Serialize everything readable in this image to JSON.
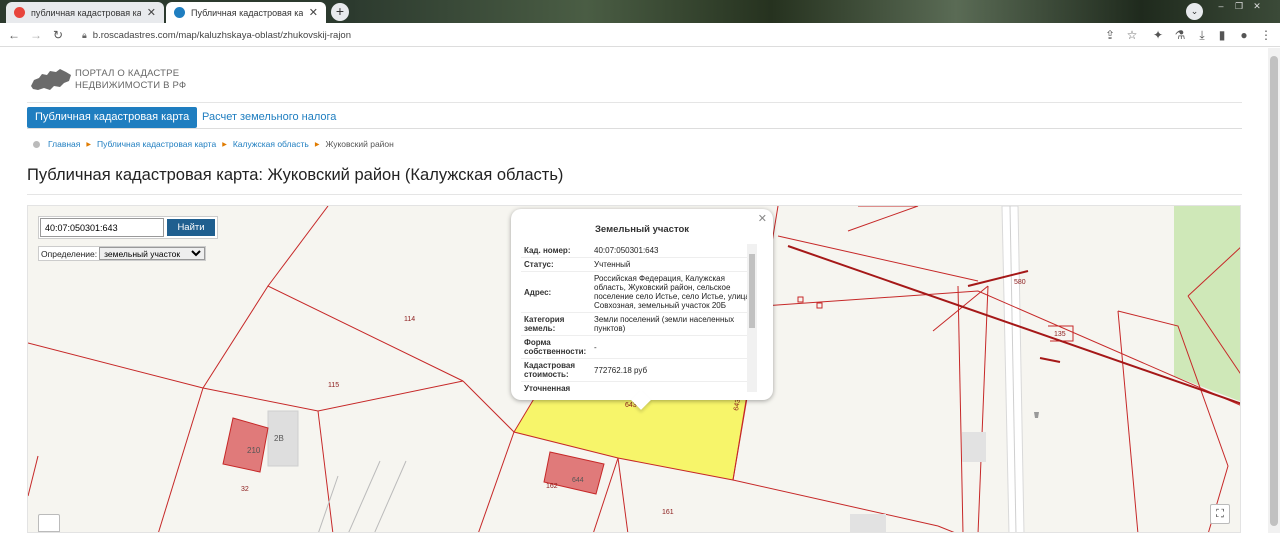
{
  "browser": {
    "tabs": [
      {
        "title": "публичная кадастровая карта ж",
        "active": false,
        "favicon_color": "#e8453c"
      },
      {
        "title": "Публичная кадастровая карта: Ж",
        "active": true,
        "favicon_color": "#1f7ec0"
      }
    ],
    "url": "b.roscadastres.com/map/kaluzhskaya-oblast/zhukovskij-rajon"
  },
  "site": {
    "logo_line1": "ПОРТАЛ О КАДАСТРЕ",
    "logo_line2": "НЕДВИЖИМОСТИ В РФ",
    "nav": {
      "active": "Публичная кадастровая карта",
      "other": "Расчет земельного налога"
    },
    "breadcrumb": [
      "Главная",
      "Публичная кадастровая карта",
      "Калужская область",
      "Жуковский район"
    ],
    "page_title": "Публичная кадастровая карта: Жуковский район (Калужская область)"
  },
  "map": {
    "search_value": "40:07:050301:643",
    "search_button": "Найти",
    "definition_label": "Определение:",
    "definition_value": "земельный участок",
    "labels": {
      "l114": "114",
      "l115": "115",
      "l32": "32",
      "l162": "162",
      "l161": "161",
      "l580": "580",
      "l135": "135",
      "l643": "643",
      "l643v": "643",
      "l2B": "2В",
      "l210": "210",
      "l644": "644"
    },
    "colors": {
      "boundary": "#c62828",
      "selected": "#f7f56a",
      "building": "#e07a7a",
      "green": "#cfe8b8"
    }
  },
  "popup": {
    "title": "Земельный участок",
    "rows": [
      {
        "key": "Кад. номер:",
        "value": "40:07:050301:643"
      },
      {
        "key": "Статус:",
        "value": "Учтенный"
      },
      {
        "key": "Адрес:",
        "value": "Российская Федерация, Калужская область, Жуковский район, сельское поселение село Истье, село Истье, улица Совхозная, земельный участок 20Б"
      },
      {
        "key": "Категория земель:",
        "value": "Земли поселений (земли населенных пунктов)"
      },
      {
        "key": "Форма собственности:",
        "value": "-"
      },
      {
        "key": "Кадастровая стоимость:",
        "value": "772762.18 руб"
      },
      {
        "key": "Уточненная",
        "value": ""
      }
    ]
  }
}
